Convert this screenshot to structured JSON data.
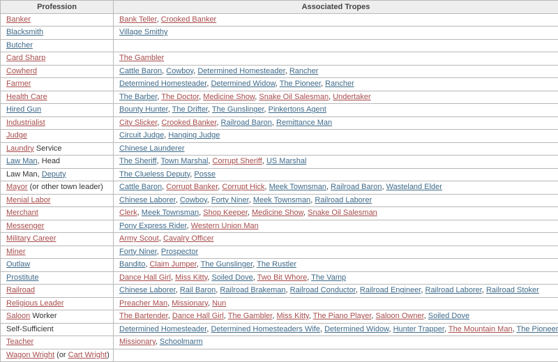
{
  "table": {
    "headers": [
      "Profession",
      "Associated Tropes"
    ],
    "link_colors": {
      "red": "#a84c4c",
      "blue": "#3e6a8a"
    },
    "rows": [
      {
        "profession": [
          {
            "text": "Banker",
            "link": "red"
          }
        ],
        "tropes": [
          {
            "text": "Bank Teller",
            "link": "red"
          },
          {
            "text": "Crooked Banker",
            "link": "red"
          }
        ]
      },
      {
        "profession": [
          {
            "text": "Blacksmith",
            "link": "blue"
          }
        ],
        "tropes": [
          {
            "text": "Village Smithy",
            "link": "blue"
          }
        ]
      },
      {
        "profession": [
          {
            "text": "Butcher",
            "link": "blue"
          }
        ],
        "tropes": []
      },
      {
        "profession": [
          {
            "text": "Card Sharp",
            "link": "red"
          }
        ],
        "tropes": [
          {
            "text": "The Gambler",
            "link": "red"
          }
        ]
      },
      {
        "profession": [
          {
            "text": "Cowherd",
            "link": "red"
          }
        ],
        "tropes": [
          {
            "text": "Cattle Baron",
            "link": "blue"
          },
          {
            "text": "Cowboy",
            "link": "blue"
          },
          {
            "text": "Determined Homesteader",
            "link": "blue"
          },
          {
            "text": "Rancher",
            "link": "blue"
          }
        ]
      },
      {
        "profession": [
          {
            "text": "Farmer",
            "link": "red"
          }
        ],
        "tropes": [
          {
            "text": "Determined Homesteader",
            "link": "blue"
          },
          {
            "text": "Determined Widow",
            "link": "blue"
          },
          {
            "text": "The Pioneer",
            "link": "blue"
          },
          {
            "text": "Rancher",
            "link": "blue"
          }
        ]
      },
      {
        "profession": [
          {
            "text": "Health Care",
            "link": "red"
          }
        ],
        "tropes": [
          {
            "text": "The Barber",
            "link": "blue"
          },
          {
            "text": "The Doctor",
            "link": "red"
          },
          {
            "text": "Medicine Show",
            "link": "red"
          },
          {
            "text": "Snake Oil Salesman",
            "link": "red"
          },
          {
            "text": "Undertaker",
            "link": "red"
          }
        ]
      },
      {
        "profession": [
          {
            "text": "Hired Gun",
            "link": "blue"
          }
        ],
        "tropes": [
          {
            "text": "Bounty Hunter",
            "link": "blue"
          },
          {
            "text": "The Drifter",
            "link": "blue"
          },
          {
            "text": "The Gunslinger",
            "link": "blue"
          },
          {
            "text": "Pinkertons Agent",
            "link": "blue"
          }
        ]
      },
      {
        "profession": [
          {
            "text": "Industrialist",
            "link": "red"
          }
        ],
        "tropes": [
          {
            "text": "City Slicker",
            "link": "red"
          },
          {
            "text": "Crooked Banker",
            "link": "red"
          },
          {
            "text": "Railroad Baron",
            "link": "blue"
          },
          {
            "text": "Remittance Man",
            "link": "blue"
          }
        ]
      },
      {
        "profession": [
          {
            "text": "Judge",
            "link": "red"
          }
        ],
        "tropes": [
          {
            "text": "Circuit Judge",
            "link": "blue"
          },
          {
            "text": "Hanging Judge",
            "link": "blue"
          }
        ]
      },
      {
        "profession": [
          {
            "text": "Laundry",
            "link": "red"
          },
          {
            "text": " Service",
            "link": null
          }
        ],
        "tropes": [
          {
            "text": "Chinese Launderer",
            "link": "blue"
          }
        ]
      },
      {
        "profession": [
          {
            "text": "Law Man",
            "link": "blue"
          },
          {
            "text": ", Head",
            "link": null
          }
        ],
        "tropes": [
          {
            "text": "The Sheriff",
            "link": "blue"
          },
          {
            "text": "Town Marshal",
            "link": "blue"
          },
          {
            "text": "Corrupt Sheriff",
            "link": "red"
          },
          {
            "text": "US Marshal",
            "link": "blue"
          }
        ]
      },
      {
        "profession": [
          {
            "text": "Law Man, ",
            "link": null
          },
          {
            "text": "Deputy",
            "link": "blue"
          }
        ],
        "tropes": [
          {
            "text": "The Clueless Deputy",
            "link": "blue"
          },
          {
            "text": "Posse",
            "link": "blue"
          }
        ]
      },
      {
        "profession": [
          {
            "text": "Mayor",
            "link": "red"
          },
          {
            "text": " (or other town leader)",
            "link": null
          }
        ],
        "tropes": [
          {
            "text": "Cattle Baron",
            "link": "blue"
          },
          {
            "text": "Corrupt Banker",
            "link": "red"
          },
          {
            "text": "Corrupt Hick",
            "link": "red"
          },
          {
            "text": "Meek Townsman",
            "link": "blue"
          },
          {
            "text": "Railroad Baron",
            "link": "blue"
          },
          {
            "text": "Wasteland Elder",
            "link": "blue"
          }
        ]
      },
      {
        "profession": [
          {
            "text": "Menial Labor",
            "link": "red"
          }
        ],
        "tropes": [
          {
            "text": "Chinese Laborer",
            "link": "blue"
          },
          {
            "text": "Cowboy",
            "link": "blue"
          },
          {
            "text": "Forty Niner",
            "link": "blue"
          },
          {
            "text": "Meek Townsman",
            "link": "blue"
          },
          {
            "text": "Railroad Laborer",
            "link": "blue"
          }
        ]
      },
      {
        "profession": [
          {
            "text": "Merchant",
            "link": "red"
          }
        ],
        "tropes": [
          {
            "text": "Clerk",
            "link": "red"
          },
          {
            "text": "Meek Townsman",
            "link": "blue"
          },
          {
            "text": "Shop Keeper",
            "link": "red"
          },
          {
            "text": "Medicine Show",
            "link": "red"
          },
          {
            "text": "Snake Oil Salesman",
            "link": "red"
          }
        ]
      },
      {
        "profession": [
          {
            "text": "Messenger",
            "link": "red"
          }
        ],
        "tropes": [
          {
            "text": "Pony Express Rider",
            "link": "blue"
          },
          {
            "text": "Western Union Man",
            "link": "red"
          }
        ]
      },
      {
        "profession": [
          {
            "text": "Military Career",
            "link": "red"
          }
        ],
        "tropes": [
          {
            "text": "Army Scout",
            "link": "red"
          },
          {
            "text": "Cavalry Officer",
            "link": "red"
          }
        ]
      },
      {
        "profession": [
          {
            "text": "Miner",
            "link": "red"
          }
        ],
        "tropes": [
          {
            "text": "Forty Niner",
            "link": "blue"
          },
          {
            "text": "Prospector",
            "link": "blue"
          }
        ]
      },
      {
        "profession": [
          {
            "text": "Outlaw",
            "link": "blue"
          }
        ],
        "tropes": [
          {
            "text": "Bandito",
            "link": "blue"
          },
          {
            "text": "Claim Jumper",
            "link": "red"
          },
          {
            "text": "The Gunslinger",
            "link": "blue"
          },
          {
            "text": "The Rustler",
            "link": "blue"
          }
        ]
      },
      {
        "profession": [
          {
            "text": "Prostitute",
            "link": "blue"
          }
        ],
        "tropes": [
          {
            "text": "Dance Hall Girl",
            "link": "red"
          },
          {
            "text": "Miss Kitty",
            "link": "red"
          },
          {
            "text": "Soiled Dove",
            "link": "blue"
          },
          {
            "text": "Two Bit Whore",
            "link": "red"
          },
          {
            "text": "The Vamp",
            "link": "blue"
          }
        ]
      },
      {
        "profession": [
          {
            "text": "Railroad",
            "link": "red"
          }
        ],
        "tropes": [
          {
            "text": "Chinese Laborer",
            "link": "blue"
          },
          {
            "text": "Rail Baron",
            "link": "blue"
          },
          {
            "text": "Railroad Brakeman",
            "link": "blue"
          },
          {
            "text": "Railroad Conductor",
            "link": "blue"
          },
          {
            "text": "Railroad Engineer",
            "link": "blue"
          },
          {
            "text": "Railroad Laborer",
            "link": "blue"
          },
          {
            "text": "Railroad Stoker",
            "link": "blue"
          }
        ]
      },
      {
        "profession": [
          {
            "text": "Religious Leader",
            "link": "red"
          }
        ],
        "tropes": [
          {
            "text": "Preacher Man",
            "link": "red"
          },
          {
            "text": "Missionary",
            "link": "red"
          },
          {
            "text": "Nun",
            "link": "red"
          }
        ]
      },
      {
        "profession": [
          {
            "text": "Saloon",
            "link": "red"
          },
          {
            "text": " Worker",
            "link": null
          }
        ],
        "tropes": [
          {
            "text": "The Bartender",
            "link": "red"
          },
          {
            "text": "Dance Hall Girl",
            "link": "red"
          },
          {
            "text": "The Gambler",
            "link": "red"
          },
          {
            "text": "Miss Kitty",
            "link": "red"
          },
          {
            "text": "The Piano Player",
            "link": "red"
          },
          {
            "text": "Saloon Owner",
            "link": "red"
          },
          {
            "text": "Soiled Dove",
            "link": "blue"
          }
        ]
      },
      {
        "profession": [
          {
            "text": "Self-Sufficient",
            "link": null
          }
        ],
        "tropes": [
          {
            "text": "Determined Homesteader",
            "link": "blue"
          },
          {
            "text": "Determined Homesteaders Wife",
            "link": "blue"
          },
          {
            "text": "Determined Widow",
            "link": "blue"
          },
          {
            "text": "Hunter Trapper",
            "link": "blue"
          },
          {
            "text": "The Mountain Man",
            "link": "red"
          },
          {
            "text": "The Pioneer",
            "link": "blue"
          }
        ]
      },
      {
        "profession": [
          {
            "text": "Teacher",
            "link": "red"
          }
        ],
        "tropes": [
          {
            "text": "Missionary",
            "link": "red"
          },
          {
            "text": "Schoolmarm",
            "link": "blue"
          }
        ]
      },
      {
        "profession": [
          {
            "text": "Wagon Wright",
            "link": "red"
          },
          {
            "text": " (or ",
            "link": null
          },
          {
            "text": "Cart Wright",
            "link": "red"
          },
          {
            "text": ")",
            "link": null
          }
        ],
        "tropes": []
      }
    ]
  }
}
